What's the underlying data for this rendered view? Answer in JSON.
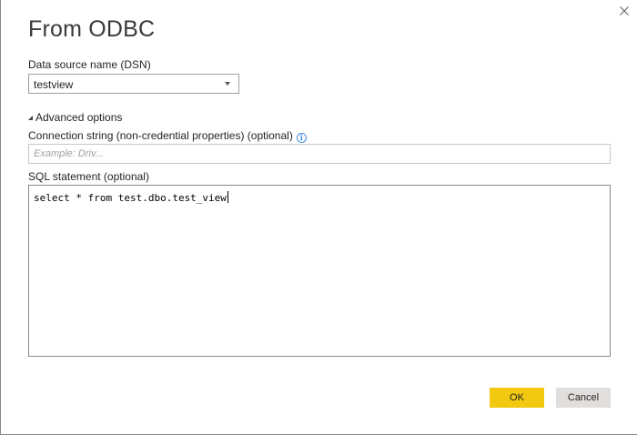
{
  "dialog": {
    "title": "From ODBC",
    "close_icon": "close-icon"
  },
  "dsn": {
    "label": "Data source name (DSN)",
    "selected": "testview"
  },
  "advanced": {
    "toggle_label": "Advanced options",
    "expanded": true
  },
  "connection_string": {
    "label": "Connection string (non-credential properties) (optional)",
    "placeholder": "Example: Driv...",
    "value": "",
    "info_icon": "info-icon"
  },
  "sql": {
    "label": "SQL statement (optional)",
    "value": "select * from test.dbo.test_view"
  },
  "buttons": {
    "ok": "OK",
    "cancel": "Cancel"
  },
  "colors": {
    "ok_button": "#f2c811",
    "cancel_button": "#e1dfdd",
    "info_icon": "#3f8ed9"
  }
}
